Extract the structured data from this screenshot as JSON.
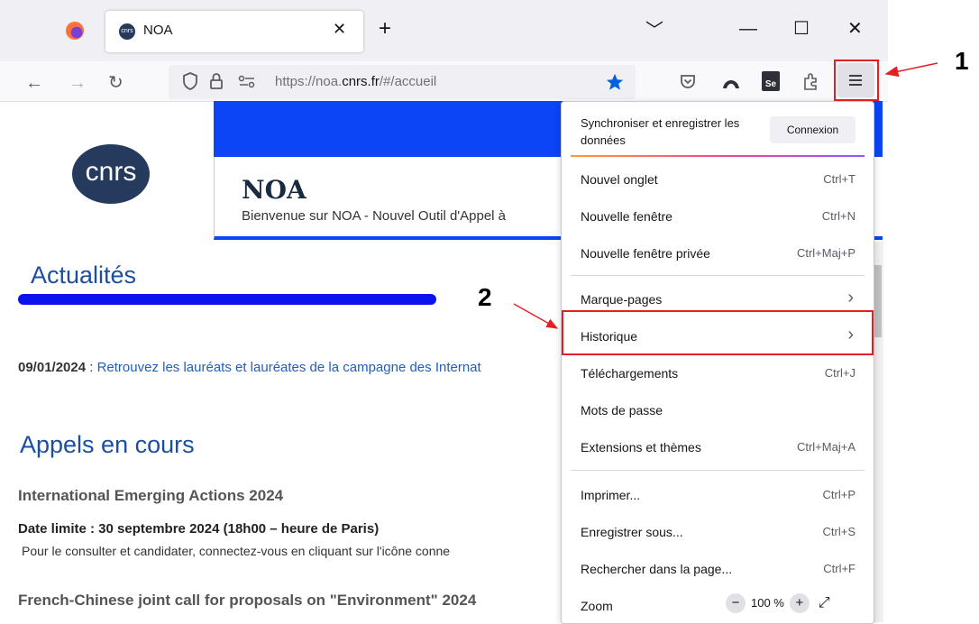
{
  "browser": {
    "tab_title": "NOA",
    "tab_favicon_text": "cnrs",
    "new_tab_symbol": "+",
    "close_symbol": "✕",
    "url_prefix": "https://noa.",
    "url_domain": "cnrs.fr",
    "url_path": "/#/accueil",
    "window_controls": [
      "﹀",
      "—",
      "☐",
      "✕"
    ]
  },
  "page": {
    "logo_text": "cnrs",
    "site_title": "NOA",
    "site_subtitle": "Bienvenue sur NOA - Nouvel Outil d'Appel à",
    "news_heading": "Actualités",
    "news_date": "09/01/2024",
    "news_sep": " : ",
    "news_link": "Retrouvez les lauréats et lauréates de la campagne des Internat",
    "calls_heading": "Appels en cours",
    "call1_title": "International Emerging Actions 2024",
    "call1_deadline": "Date limite : 30 septembre 2024 (18h00 – heure de Paris)",
    "call1_desc": "Pour le consulter et candidater, connectez-vous en cliquant sur l'icône conne",
    "call2_title": "French-Chinese joint call for proposals on \"Environment\" 2024"
  },
  "menu": {
    "sync_text": "Synchroniser et enregistrer les données",
    "connect_button": "Connexion",
    "items": [
      {
        "label": "Nouvel onglet",
        "shortcut": "Ctrl+T"
      },
      {
        "label": "Nouvelle fenêtre",
        "shortcut": "Ctrl+N"
      },
      {
        "label": "Nouvelle fenêtre privée",
        "shortcut": "Ctrl+Maj+P"
      },
      {
        "label": "Marque-pages",
        "shortcut": ""
      },
      {
        "label": "Historique",
        "shortcut": ""
      },
      {
        "label": "Téléchargements",
        "shortcut": "Ctrl+J"
      },
      {
        "label": "Mots de passe",
        "shortcut": ""
      },
      {
        "label": "Extensions et thèmes",
        "shortcut": "Ctrl+Maj+A"
      },
      {
        "label": "Imprimer...",
        "shortcut": "Ctrl+P"
      },
      {
        "label": "Enregistrer sous...",
        "shortcut": "Ctrl+S"
      },
      {
        "label": "Rechercher dans la page...",
        "shortcut": "Ctrl+F"
      },
      {
        "label": "Zoom",
        "shortcut": ""
      }
    ],
    "zoom_value": "100 %",
    "zoom_minus": "−",
    "zoom_plus": "+",
    "chevron": "›"
  },
  "annotations": {
    "step1": "1",
    "step2": "2",
    "color": "#e31e24"
  }
}
